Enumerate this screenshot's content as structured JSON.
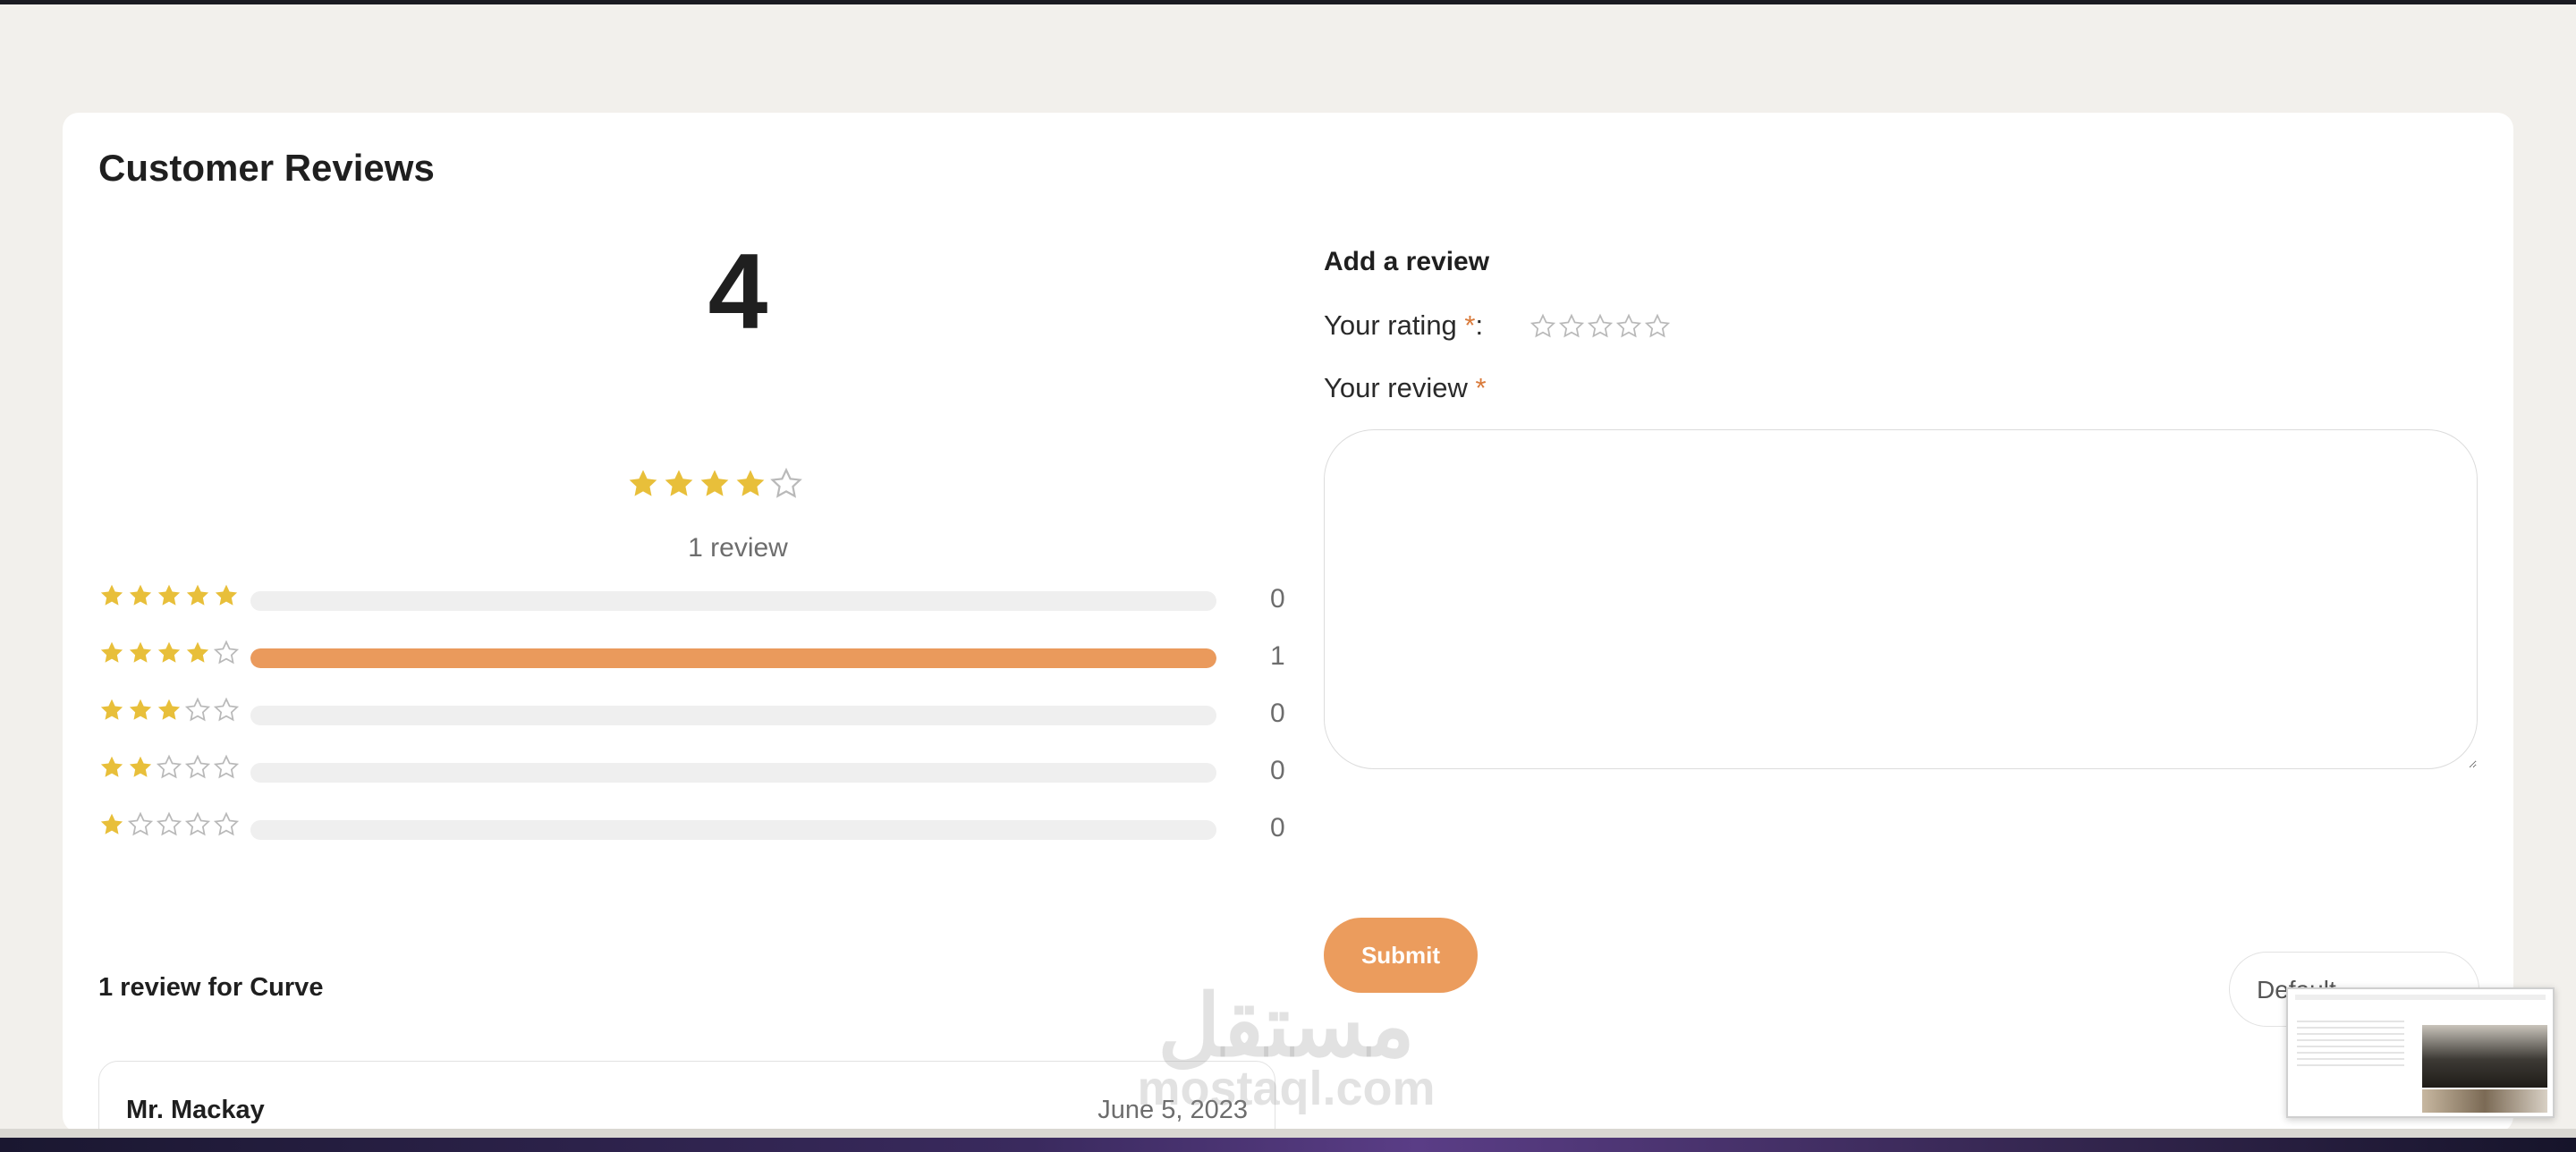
{
  "section": {
    "title": "Customer Reviews"
  },
  "summary": {
    "average": "4",
    "average_stars": 4,
    "max_stars": 5,
    "review_count_text": "1 review"
  },
  "distribution": [
    {
      "stars": 5,
      "count": "0",
      "fraction": 0
    },
    {
      "stars": 4,
      "count": "1",
      "fraction": 1
    },
    {
      "stars": 3,
      "count": "0",
      "fraction": 0
    },
    {
      "stars": 2,
      "count": "0",
      "fraction": 0
    },
    {
      "stars": 1,
      "count": "0",
      "fraction": 0
    }
  ],
  "form": {
    "title": "Add a review",
    "rating_label": "Your rating",
    "rating_colon": ":",
    "required_mark": "*",
    "review_label": "Your review",
    "review_value": "",
    "submit_label": "Submit"
  },
  "list": {
    "title": "1 review for Curve",
    "sort_selected": "Default",
    "reviews": [
      {
        "author": "Mr. Mackay",
        "date": "June 5, 2023"
      }
    ]
  },
  "watermark": {
    "arabic": "مستقل",
    "latin": "mostaql.com"
  },
  "colors": {
    "star_filled": "#e8bf3a",
    "star_empty": "#b9b9b9",
    "bar_fill": "#ea9a5c",
    "bar_track": "#efefef",
    "accent": "#eb9c5d",
    "required": "#d97a3a",
    "page_bg": "#f2f0ec"
  },
  "icons": {
    "star_filled": "star-filled-icon",
    "star_empty": "star-outline-icon",
    "select_chevron": "chevron-down-icon"
  }
}
